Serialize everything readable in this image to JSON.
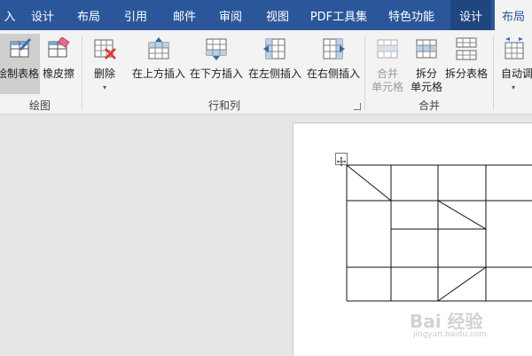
{
  "tabs": [
    {
      "label": "入"
    },
    {
      "label": "设计"
    },
    {
      "label": "布局"
    },
    {
      "label": "引用"
    },
    {
      "label": "邮件"
    },
    {
      "label": "审阅"
    },
    {
      "label": "视图"
    },
    {
      "label": "PDF工具集"
    },
    {
      "label": "特色功能"
    },
    {
      "label": "设计"
    },
    {
      "label": "布局"
    }
  ],
  "ribbon": {
    "draw_group": {
      "label": "绘图",
      "draw_table": "绘制表格",
      "eraser": "橡皮擦"
    },
    "rows_cols_group": {
      "label": "行和列",
      "delete": "删除",
      "insert_above": "在上方插入",
      "insert_below": "在下方插入",
      "insert_left": "在左侧插入",
      "insert_right": "在右侧插入"
    },
    "merge_group": {
      "label": "合并",
      "merge_cells_1": "合并",
      "merge_cells_2": "单元格",
      "split_cells_1": "拆分",
      "split_cells_2": "单元格",
      "split_table": "拆分表格"
    },
    "cell_size_group": {
      "autofit": "自动调"
    }
  },
  "watermark": {
    "brand": "Bai 经验",
    "url": "jingyan.baidu.com"
  }
}
